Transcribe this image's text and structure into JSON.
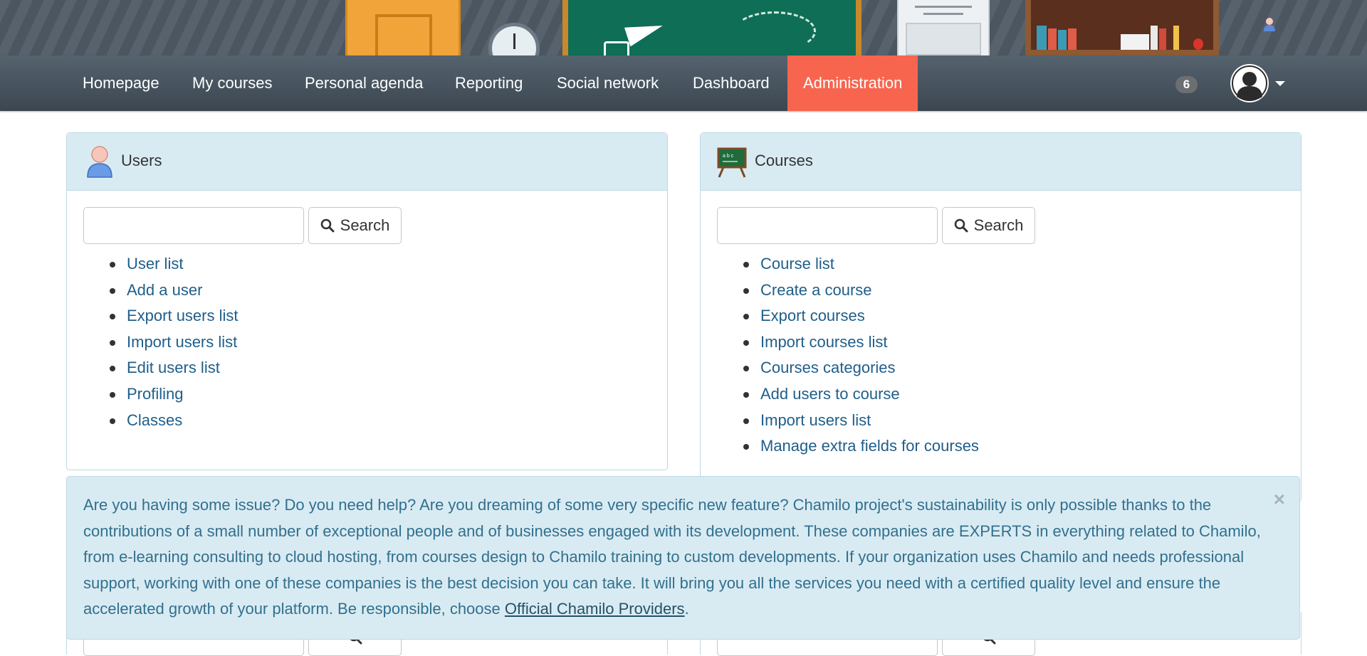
{
  "nav": {
    "items": [
      {
        "label": "Homepage"
      },
      {
        "label": "My courses"
      },
      {
        "label": "Personal agenda"
      },
      {
        "label": "Reporting"
      },
      {
        "label": "Social network"
      },
      {
        "label": "Dashboard"
      },
      {
        "label": "Administration",
        "active": true
      }
    ],
    "notification_count": "6",
    "active_color": "#f7654f"
  },
  "users_panel": {
    "title": "Users",
    "search_label": "Search",
    "search_value": "",
    "links": [
      "User list",
      "Add a user",
      "Export users list",
      "Import users list",
      "Edit users list",
      "Profiling",
      "Classes"
    ]
  },
  "courses_panel": {
    "title": "Courses",
    "search_label": "Search",
    "search_value": "",
    "links": [
      "Course list",
      "Create a course",
      "Export courses",
      "Import courses list",
      "Courses categories",
      "Add users to course",
      "Import users list",
      "Manage extra fields for courses"
    ]
  },
  "alert": {
    "message": "Are you having some issue? Do you need help? Are you dreaming of some very specific new feature? Chamilo project's sustainability is only possible thanks to the contributions of a small number of exceptional people and of businesses engaged with its development. These companies are EXPERTS in everything related to Chamilo, from e-learning consulting to cloud hosting, from courses design to Chamilo training to custom developments. If your organization uses Chamilo and needs professional support, working with one of these companies is the best decision you can take. It will bring you all the services you need with a certified quality level and ensure the accelerated growth of your platform. Be responsible, choose ",
    "link_text": "Official Chamilo Providers",
    "suffix": ".",
    "close_symbol": "×"
  },
  "colors": {
    "link": "#1f5e8a",
    "panel_heading": "#d9ebf2",
    "alert_text": "#31708f"
  }
}
